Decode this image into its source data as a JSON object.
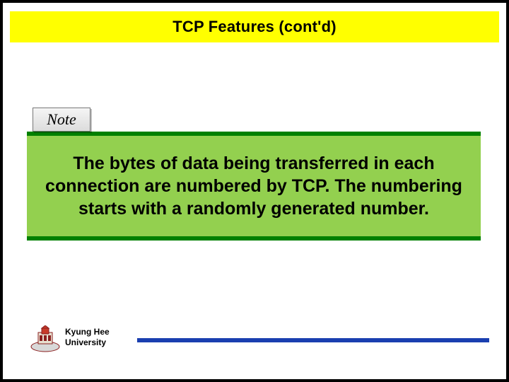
{
  "slide": {
    "title": "TCP Features (cont'd)",
    "note_label": "Note",
    "note_body": "The bytes of data being transferred in each connection are numbered by TCP. The numbering starts with a randomly generated number."
  },
  "footer": {
    "university_line1": "Kyung Hee",
    "university_line2": "University"
  },
  "colors": {
    "title_bg": "#ffff00",
    "note_rule": "#008000",
    "note_bg": "#93d04f",
    "footer_rule": "#1a3fb0"
  }
}
